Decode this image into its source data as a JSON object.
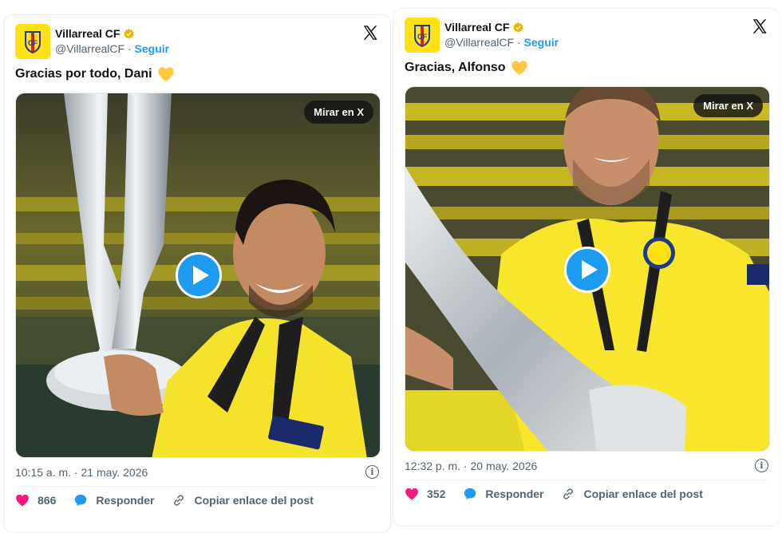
{
  "cards": [
    {
      "author": {
        "name": "Villarreal CF",
        "handle": "@VillarrealCF",
        "separator": "·",
        "follow": "Seguir"
      },
      "text": "Gracias por todo, Dani",
      "media": {
        "cta": "Mirar en X"
      },
      "meta": {
        "time": "10:15 a. m.",
        "separator": "·",
        "date": "21 may. 2026"
      },
      "actions": {
        "likes": "866",
        "reply": "Responder",
        "copy": "Copiar enlace del post"
      }
    },
    {
      "author": {
        "name": "Villarreal CF",
        "handle": "@VillarrealCF",
        "separator": "·",
        "follow": "Seguir"
      },
      "text": "Gracias, Alfonso",
      "media": {
        "cta": "Mirar en X"
      },
      "meta": {
        "time": "12:32 p. m.",
        "separator": "·",
        "date": "20 may. 2026"
      },
      "actions": {
        "likes": "352",
        "reply": "Responder",
        "copy": "Copiar enlace del post"
      }
    }
  ],
  "colors": {
    "accent": "#1d9bf0",
    "heart": "#f91880",
    "club_yellow": "#ffe114",
    "verified": "#e8b400"
  },
  "icons": [
    "verified-badge-icon",
    "x-logo-icon",
    "yellow-heart-emoji-icon",
    "play-icon",
    "info-icon",
    "heart-icon",
    "reply-bubble-icon",
    "link-icon"
  ]
}
